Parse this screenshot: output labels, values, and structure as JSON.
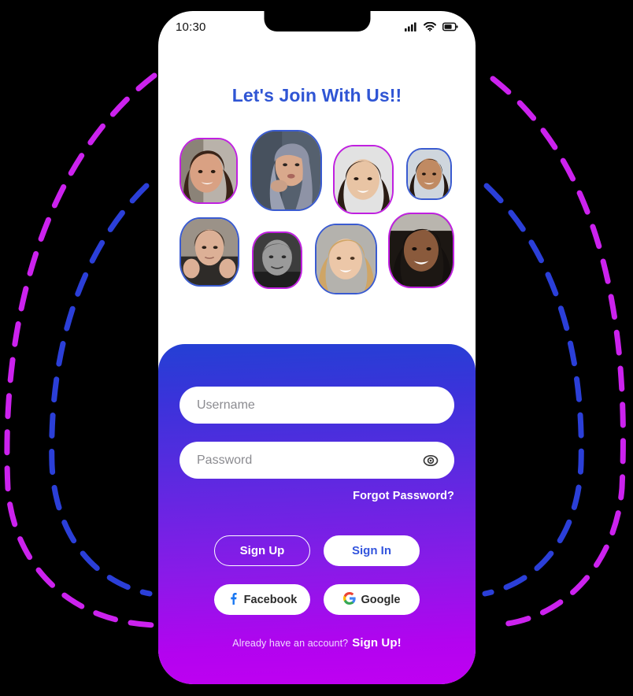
{
  "status_bar": {
    "time": "10:30",
    "icons": [
      "signal-icon",
      "wifi-icon",
      "battery-icon"
    ]
  },
  "screen": {
    "title": "Let's Join With Us!!"
  },
  "avatars": [
    {
      "name": "avatar-1",
      "border": "#c020e0",
      "skin": "#d9a183",
      "hair": "#3a2418",
      "bg": "#b9b2aa"
    },
    {
      "name": "avatar-2",
      "border": "#3a5bd0",
      "skin": "#d9a98c",
      "hair": "#8e93a6",
      "bg": "#55606e"
    },
    {
      "name": "avatar-3",
      "border": "#c020e0",
      "skin": "#e8c4a4",
      "hair": "#2a1c14",
      "bg": "#e2e2e2"
    },
    {
      "name": "avatar-4",
      "border": "#3a5bd0",
      "skin": "#c08a62",
      "hair": "#241812",
      "bg": "#cfd6dd"
    },
    {
      "name": "avatar-5",
      "border": "#3a5bd0",
      "skin": "#dcb096",
      "hair": "#4a3527",
      "bg": "#9b9288"
    },
    {
      "name": "avatar-6",
      "border": "#c020e0",
      "skin": "#9a9a9a",
      "hair": "#5f5f5f",
      "bg": "#3d3d3d"
    },
    {
      "name": "avatar-7",
      "border": "#3a5bd0",
      "skin": "#ecc7a8",
      "hair": "#cfa566",
      "bg": "#b4b2ad"
    },
    {
      "name": "avatar-8",
      "border": "#c020e0",
      "skin": "#8a5a3c",
      "hair": "#14100e",
      "bg": "#1c1713"
    }
  ],
  "form": {
    "username": {
      "placeholder": "Username",
      "value": ""
    },
    "password": {
      "placeholder": "Password",
      "value": "",
      "toggle_icon": "eye-icon"
    },
    "forgot_label": "Forgot Password?"
  },
  "actions": {
    "sign_up": "Sign Up",
    "sign_in": "Sign In",
    "facebook": "Facebook",
    "google": "Google"
  },
  "footer": {
    "prompt": "Already have an account?",
    "link": "Sign Up!"
  },
  "colors": {
    "title": "#2f55d4",
    "card_top": "#2440d4",
    "card_bottom": "#c000f2",
    "sign_in_text": "#3355dd",
    "arc_outer": "#cc22ee",
    "arc_inner": "#2b3fd8",
    "facebook_blue": "#1877f2"
  }
}
